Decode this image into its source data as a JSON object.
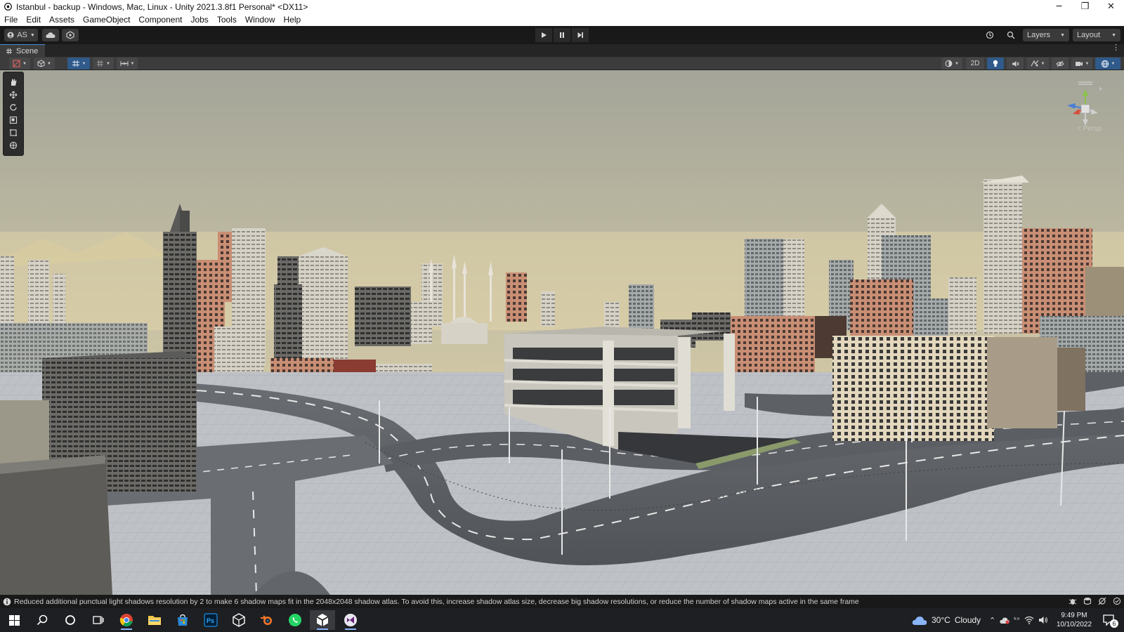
{
  "window": {
    "title": "Istanbul - backup - Windows, Mac, Linux - Unity 2021.3.8f1 Personal* <DX11>",
    "controls": [
      "─",
      "❐",
      "✕"
    ]
  },
  "menu": [
    "File",
    "Edit",
    "Assets",
    "GameObject",
    "Component",
    "Jobs",
    "Tools",
    "Window",
    "Help"
  ],
  "toolbar": {
    "account": "AS",
    "layers": "Layers",
    "layout": "Layout"
  },
  "scene_tab": {
    "label": "Scene"
  },
  "scene_toolbar": {
    "mode_2d": "2D"
  },
  "gizmo": {
    "persp_label": "< Persp"
  },
  "console": {
    "message": "Reduced additional punctual light shadows resolution by 2 to make 6 shadow maps fit in the 2048x2048 shadow atlas. To avoid this, increase shadow atlas size, decrease big shadow resolutions, or reduce the number of shadow maps active in the same frame"
  },
  "taskbar": {
    "weather_temp": "30°C",
    "weather_desc": "Cloudy",
    "time": "9:49 PM",
    "date": "10/10/2022",
    "notification_count": "6"
  },
  "colors": {
    "sky_top": "#a9a89a",
    "sky_horizon": "#e6d8a8",
    "road": "#5a5d62",
    "ground": "#b9bcc2",
    "accent_blue": "#4a90d9"
  }
}
